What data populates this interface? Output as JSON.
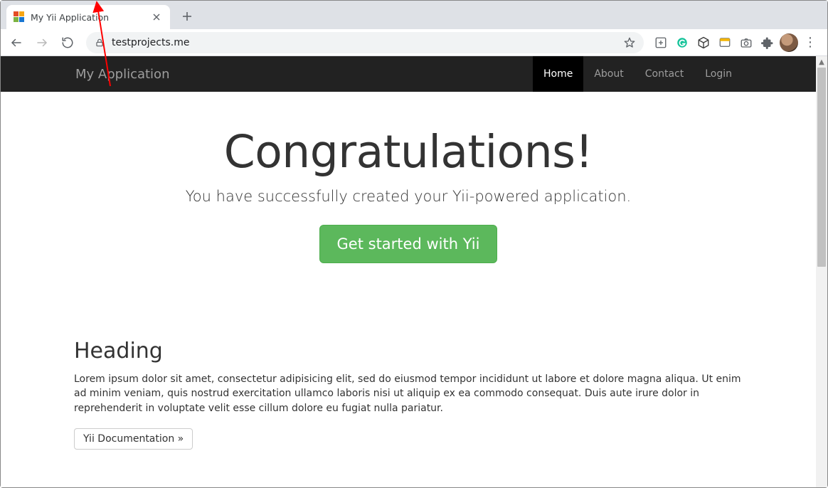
{
  "browser": {
    "tab_title": "My Yii Application",
    "url": "testprojects.me"
  },
  "navbar": {
    "brand": "My Application",
    "items": [
      {
        "label": "Home",
        "active": true
      },
      {
        "label": "About",
        "active": false
      },
      {
        "label": "Contact",
        "active": false
      },
      {
        "label": "Login",
        "active": false
      }
    ]
  },
  "jumbotron": {
    "title": "Congratulations!",
    "lead": "You have successfully created your Yii-powered application.",
    "button": "Get started with Yii"
  },
  "section": {
    "heading": "Heading",
    "paragraph": "Lorem ipsum dolor sit amet, consectetur adipisicing elit, sed do eiusmod tempor incididunt ut labore et dolore magna aliqua. Ut enim ad minim veniam, quis nostrud exercitation ullamco laboris nisi ut aliquip ex ea commodo consequat. Duis aute irure dolor in reprehenderit in voluptate velit esse cillum dolore eu fugiat nulla pariatur.",
    "doc_button": "Yii Documentation »"
  }
}
